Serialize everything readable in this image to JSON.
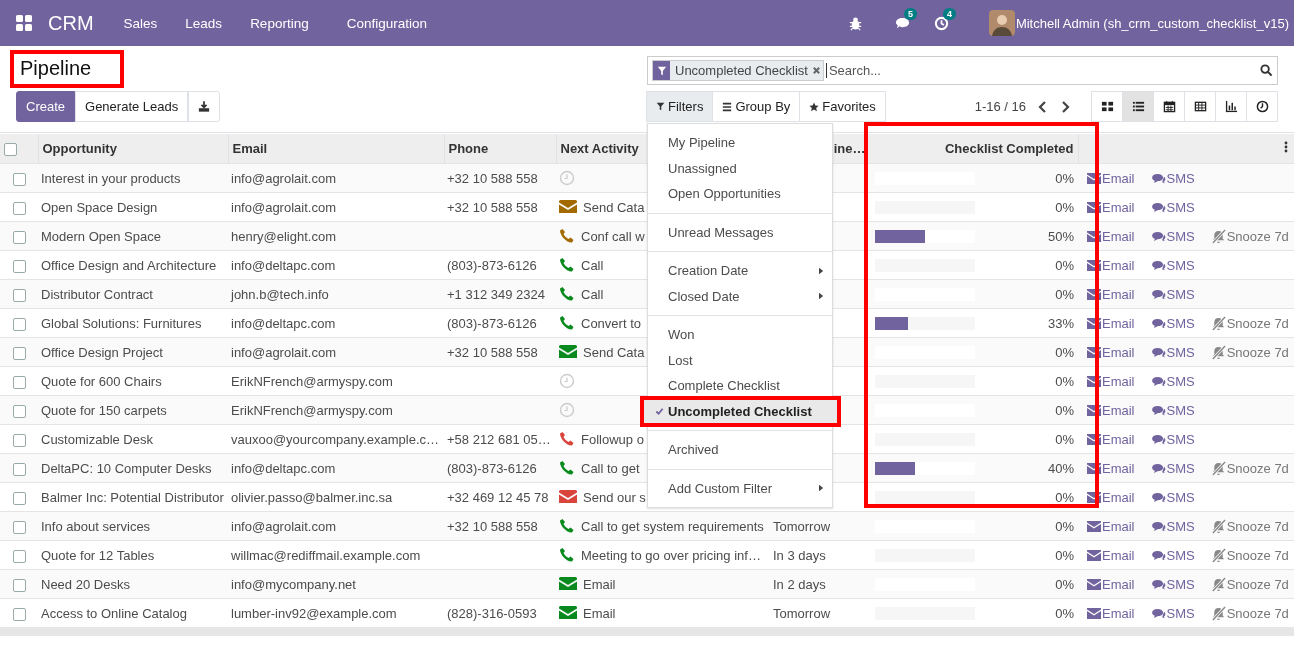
{
  "app": {
    "name": "CRM"
  },
  "menu": [
    "Sales",
    "Leads",
    "Reporting",
    "Configuration"
  ],
  "systray": {
    "messages_badge": "5",
    "activities_badge": "4",
    "user": "Mitchell Admin (sh_crm_custom_checklist_v15)"
  },
  "breadcrumb": {
    "label": "Pipeline",
    "highlight": true
  },
  "buttons": [
    "Create",
    "Generate Leads"
  ],
  "search": {
    "facet": "Uncompleted Checklist",
    "placeholder": "Search..."
  },
  "search_options": [
    {
      "kind": "filter",
      "label": "Filters",
      "selected": true
    },
    {
      "kind": "group",
      "label": "Group By",
      "selected": false
    },
    {
      "kind": "favorite",
      "label": "Favorites",
      "selected": false
    }
  ],
  "pager": "1-16 / 16",
  "views": [
    {
      "kind": "kanban",
      "selected": false
    },
    {
      "kind": "list",
      "selected": true
    },
    {
      "kind": "calendar",
      "selected": false
    },
    {
      "kind": "pivot",
      "selected": false
    },
    {
      "kind": "graph",
      "selected": false
    },
    {
      "kind": "activity",
      "selected": false
    }
  ],
  "table": {
    "columns": [
      "Opportunity",
      "Email",
      "Phone",
      "Next Activity",
      "ine…",
      "Checklist Completed"
    ],
    "checklist_highlight": true,
    "all_checked": false,
    "rows": [
      {
        "checked": false,
        "opportunity": "Interest in your products",
        "email": "info@agrolait.com",
        "phone": "+32 10 588 558",
        "activity": {
          "kind": "none"
        },
        "level": 0,
        "percent": "0%",
        "actions": [
          {
            "kind": "email",
            "label": "Email"
          },
          {
            "kind": "sms",
            "label": "SMS"
          }
        ]
      },
      {
        "checked": false,
        "opportunity": "Open Space Design",
        "email": "info@agrolait.com",
        "phone": "+32 10 588 558",
        "activity": {
          "kind": "email",
          "color": "#a26a00",
          "text": "Send Cata"
        },
        "level": 0,
        "percent": "0%",
        "actions": [
          {
            "kind": "email",
            "label": "Email"
          },
          {
            "kind": "sms",
            "label": "SMS"
          }
        ]
      },
      {
        "checked": false,
        "opportunity": "Modern Open Space",
        "email": "henry@elight.com",
        "activity": {
          "kind": "phone",
          "color": "#a26a00",
          "text": "Conf call w"
        },
        "level": 0.5,
        "percent": "50%",
        "actions": [
          {
            "kind": "email",
            "label": "Email"
          },
          {
            "kind": "sms",
            "label": "SMS"
          },
          {
            "kind": "snooze",
            "label": "Snooze 7d"
          }
        ]
      },
      {
        "checked": false,
        "opportunity": "Office Design and Architecture",
        "email": "info@deltapc.com",
        "phone": "(803)-873-6126",
        "activity": {
          "kind": "phone",
          "color": "#0a8a1e",
          "text": "Call"
        },
        "level": 0,
        "percent": "0%",
        "actions": [
          {
            "kind": "email",
            "label": "Email"
          },
          {
            "kind": "sms",
            "label": "SMS"
          }
        ]
      },
      {
        "checked": false,
        "opportunity": "Distributor Contract",
        "email": "john.b@tech.info",
        "phone": "+1 312 349 2324",
        "activity": {
          "kind": "phone",
          "color": "#0a8a1e",
          "text": "Call"
        },
        "level": 0,
        "percent": "0%",
        "actions": [
          {
            "kind": "email",
            "label": "Email"
          },
          {
            "kind": "sms",
            "label": "SMS"
          }
        ]
      },
      {
        "checked": false,
        "opportunity": "Global Solutions: Furnitures",
        "email": "info@deltapc.com",
        "phone": "(803)-873-6126",
        "activity": {
          "kind": "phone",
          "color": "#0a8a1e",
          "text": "Convert to"
        },
        "level": 0.33,
        "percent": "33%",
        "actions": [
          {
            "kind": "email",
            "label": "Email"
          },
          {
            "kind": "sms",
            "label": "SMS"
          },
          {
            "kind": "snooze",
            "label": "Snooze 7d"
          }
        ]
      },
      {
        "checked": false,
        "opportunity": "Office Design Project",
        "email": "info@agrolait.com",
        "phone": "+32 10 588 558",
        "activity": {
          "kind": "email",
          "color": "#0a8a1e",
          "text": "Send Cata"
        },
        "level": 0,
        "percent": "0%",
        "actions": [
          {
            "kind": "email",
            "label": "Email"
          },
          {
            "kind": "sms",
            "label": "SMS"
          },
          {
            "kind": "snooze",
            "label": "Snooze 7d"
          }
        ]
      },
      {
        "checked": false,
        "opportunity": "Quote for 600 Chairs",
        "email": "ErikNFrench@armyspy.com",
        "activity": {
          "kind": "none"
        },
        "level": 0,
        "percent": "0%",
        "actions": [
          {
            "kind": "email",
            "label": "Email"
          },
          {
            "kind": "sms",
            "label": "SMS"
          }
        ]
      },
      {
        "checked": false,
        "opportunity": "Quote for 150 carpets",
        "email": "ErikNFrench@armyspy.com",
        "activity": {
          "kind": "none"
        },
        "level": 0,
        "percent": "0%",
        "actions": [
          {
            "kind": "email",
            "label": "Email"
          },
          {
            "kind": "sms",
            "label": "SMS"
          }
        ]
      },
      {
        "checked": false,
        "opportunity": "Customizable Desk",
        "email": "vauxoo@yourcompany.example.c…",
        "phone": "+58 212 681 05…",
        "activity": {
          "kind": "phone",
          "color": "#d9443c",
          "text": "Followup o"
        },
        "level": 0,
        "percent": "0%",
        "actions": [
          {
            "kind": "email",
            "label": "Email"
          },
          {
            "kind": "sms",
            "label": "SMS"
          }
        ]
      },
      {
        "checked": false,
        "opportunity": "DeltaPC: 10 Computer Desks",
        "email": "info@deltapc.com",
        "phone": "(803)-873-6126",
        "activity": {
          "kind": "phone",
          "color": "#0a8a1e",
          "text": "Call to get"
        },
        "level": 0.4,
        "percent": "40%",
        "actions": [
          {
            "kind": "email",
            "label": "Email"
          },
          {
            "kind": "sms",
            "label": "SMS"
          },
          {
            "kind": "snooze",
            "label": "Snooze 7d"
          }
        ]
      },
      {
        "checked": false,
        "opportunity": "Balmer Inc: Potential Distributor",
        "email": "olivier.passo@balmer.inc.sa",
        "phone": "+32 469 12 45 78",
        "activity": {
          "kind": "email",
          "color": "#d9443c",
          "text": "Send our s"
        },
        "level": 0,
        "percent": "0%",
        "actions": [
          {
            "kind": "email",
            "label": "Email"
          },
          {
            "kind": "sms",
            "label": "SMS"
          }
        ]
      },
      {
        "checked": false,
        "opportunity": "Info about services",
        "email": "info@agrolait.com",
        "phone": "+32 10 588 558",
        "activity": {
          "kind": "phone",
          "color": "#0a8a1e",
          "text": "Call to get system requirements"
        },
        "column_5": "Tomorrow",
        "level": 0,
        "percent": "0%",
        "actions": [
          {
            "kind": "email",
            "label": "Email"
          },
          {
            "kind": "sms",
            "label": "SMS"
          },
          {
            "kind": "snooze",
            "label": "Snooze 7d"
          }
        ]
      },
      {
        "checked": false,
        "opportunity": "Quote for 12 Tables",
        "email": "willmac@rediffmail.example.com",
        "activity": {
          "kind": "phone",
          "color": "#0a8a1e",
          "text": "Meeting to go over pricing inf…"
        },
        "column_5": "In 3 days",
        "level": 0,
        "percent": "0%",
        "actions": [
          {
            "kind": "email",
            "label": "Email"
          },
          {
            "kind": "sms",
            "label": "SMS"
          },
          {
            "kind": "snooze",
            "label": "Snooze 7d"
          }
        ]
      },
      {
        "checked": false,
        "opportunity": "Need 20 Desks",
        "email": "info@mycompany.net",
        "activity": {
          "kind": "email",
          "color": "#0a8a1e",
          "text": "Email"
        },
        "column_5": "In 2 days",
        "level": 0,
        "percent": "0%",
        "actions": [
          {
            "kind": "email",
            "label": "Email"
          },
          {
            "kind": "sms",
            "label": "SMS"
          },
          {
            "kind": "snooze",
            "label": "Snooze 7d"
          }
        ]
      },
      {
        "checked": false,
        "opportunity": "Access to Online Catalog",
        "email": "lumber-inv92@example.com",
        "phone": "(828)-316-0593",
        "activity": {
          "kind": "email",
          "color": "#0a8a1e",
          "text": "Email"
        },
        "column_5": "Tomorrow",
        "level": 0,
        "percent": "0%",
        "actions": [
          {
            "kind": "email",
            "label": "Email"
          },
          {
            "kind": "sms",
            "label": "SMS"
          },
          {
            "kind": "snooze",
            "label": "Snooze 7d"
          }
        ]
      }
    ]
  },
  "filters_menu": {
    "groups": [
      [
        {
          "label": "My Pipeline",
          "selected": false,
          "submenu": false,
          "highlight": false
        },
        {
          "label": "Unassigned",
          "selected": false,
          "submenu": false,
          "highlight": false
        },
        {
          "label": "Open Opportunities",
          "selected": false,
          "submenu": false,
          "highlight": false
        }
      ],
      [
        {
          "label": "Unread Messages",
          "selected": false,
          "submenu": false,
          "highlight": false
        }
      ],
      [
        {
          "label": "Creation Date",
          "selected": false,
          "submenu": true,
          "highlight": false
        },
        {
          "label": "Closed Date",
          "selected": false,
          "submenu": true,
          "highlight": false
        }
      ],
      [
        {
          "label": "Won",
          "selected": false,
          "submenu": false,
          "highlight": false
        },
        {
          "label": "Lost",
          "selected": false,
          "submenu": false,
          "highlight": false
        },
        {
          "label": "Complete Checklist",
          "selected": false,
          "submenu": false,
          "highlight": false
        },
        {
          "label": "Uncompleted Checklist",
          "selected": true,
          "submenu": false,
          "highlight": true
        }
      ],
      [
        {
          "label": "Archived",
          "selected": false,
          "submenu": false,
          "highlight": false
        }
      ],
      [
        {
          "label": "Add Custom Filter",
          "selected": false,
          "submenu": true,
          "highlight": false
        }
      ]
    ]
  }
}
